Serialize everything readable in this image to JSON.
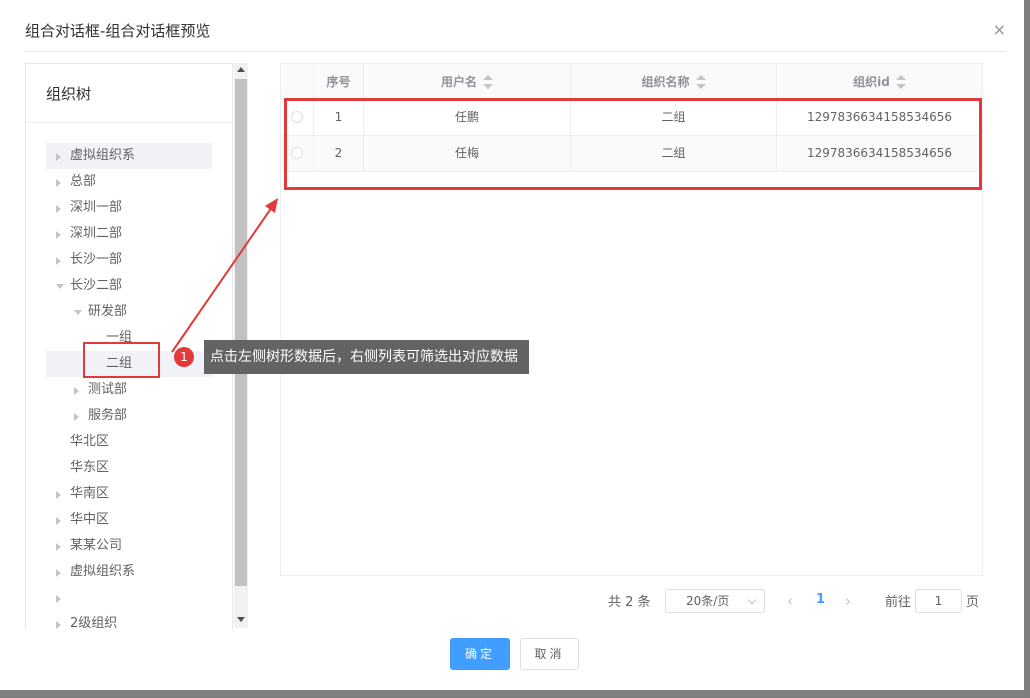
{
  "dialog": {
    "title": "组合对话框-组合对话框预览",
    "close_symbol": "×"
  },
  "tree": {
    "header": "组织树",
    "nodes": [
      {
        "label": "虚拟组织系",
        "level": 0,
        "caret": "collapsed",
        "highlight": true
      },
      {
        "label": "总部",
        "level": 0,
        "caret": "collapsed"
      },
      {
        "label": "深圳一部",
        "level": 0,
        "caret": "collapsed"
      },
      {
        "label": "深圳二部",
        "level": 0,
        "caret": "collapsed"
      },
      {
        "label": "长沙一部",
        "level": 0,
        "caret": "collapsed"
      },
      {
        "label": "长沙二部",
        "level": 0,
        "caret": "expanded"
      },
      {
        "label": "研发部",
        "level": 1,
        "caret": "expanded"
      },
      {
        "label": "一组",
        "level": 2,
        "caret": "none"
      },
      {
        "label": "二组",
        "level": 2,
        "caret": "none",
        "selected": true
      },
      {
        "label": "测试部",
        "level": 1,
        "caret": "collapsed"
      },
      {
        "label": "服务部",
        "level": 1,
        "caret": "collapsed"
      },
      {
        "label": "华北区",
        "level": 0,
        "caret": "none"
      },
      {
        "label": "华东区",
        "level": 0,
        "caret": "none"
      },
      {
        "label": "华南区",
        "level": 0,
        "caret": "collapsed"
      },
      {
        "label": "华中区",
        "level": 0,
        "caret": "collapsed"
      },
      {
        "label": "某某公司",
        "level": 0,
        "caret": "collapsed"
      },
      {
        "label": "虚拟组织系",
        "level": 0,
        "caret": "collapsed"
      },
      {
        "label": "",
        "level": 0,
        "caret": "collapsed"
      },
      {
        "label": "2级组织",
        "level": 0,
        "caret": "collapsed"
      }
    ]
  },
  "table": {
    "columns": [
      "序号",
      "用户名",
      "组织名称",
      "组织id"
    ],
    "rows": [
      {
        "index": "1",
        "username": "任鹏",
        "org_name": "二组",
        "org_id": "1297836634158534656"
      },
      {
        "index": "2",
        "username": "任梅",
        "org_name": "二组",
        "org_id": "1297836634158534656"
      }
    ]
  },
  "annotation": {
    "badge": "1",
    "text": "点击左侧树形数据后，右侧列表可筛选出对应数据",
    "color": "#e23a3a"
  },
  "pagination": {
    "total": "共 2 条",
    "page_size": "20条/页",
    "prev_icon": "chevron-left-icon",
    "next_icon": "chevron-right-icon",
    "current_page": "1",
    "goto_label": "前往",
    "goto_value": "1",
    "page_suffix": "页",
    "accent": "#409eff"
  },
  "footer": {
    "ok_label": "确定",
    "cancel_label": "取消"
  }
}
